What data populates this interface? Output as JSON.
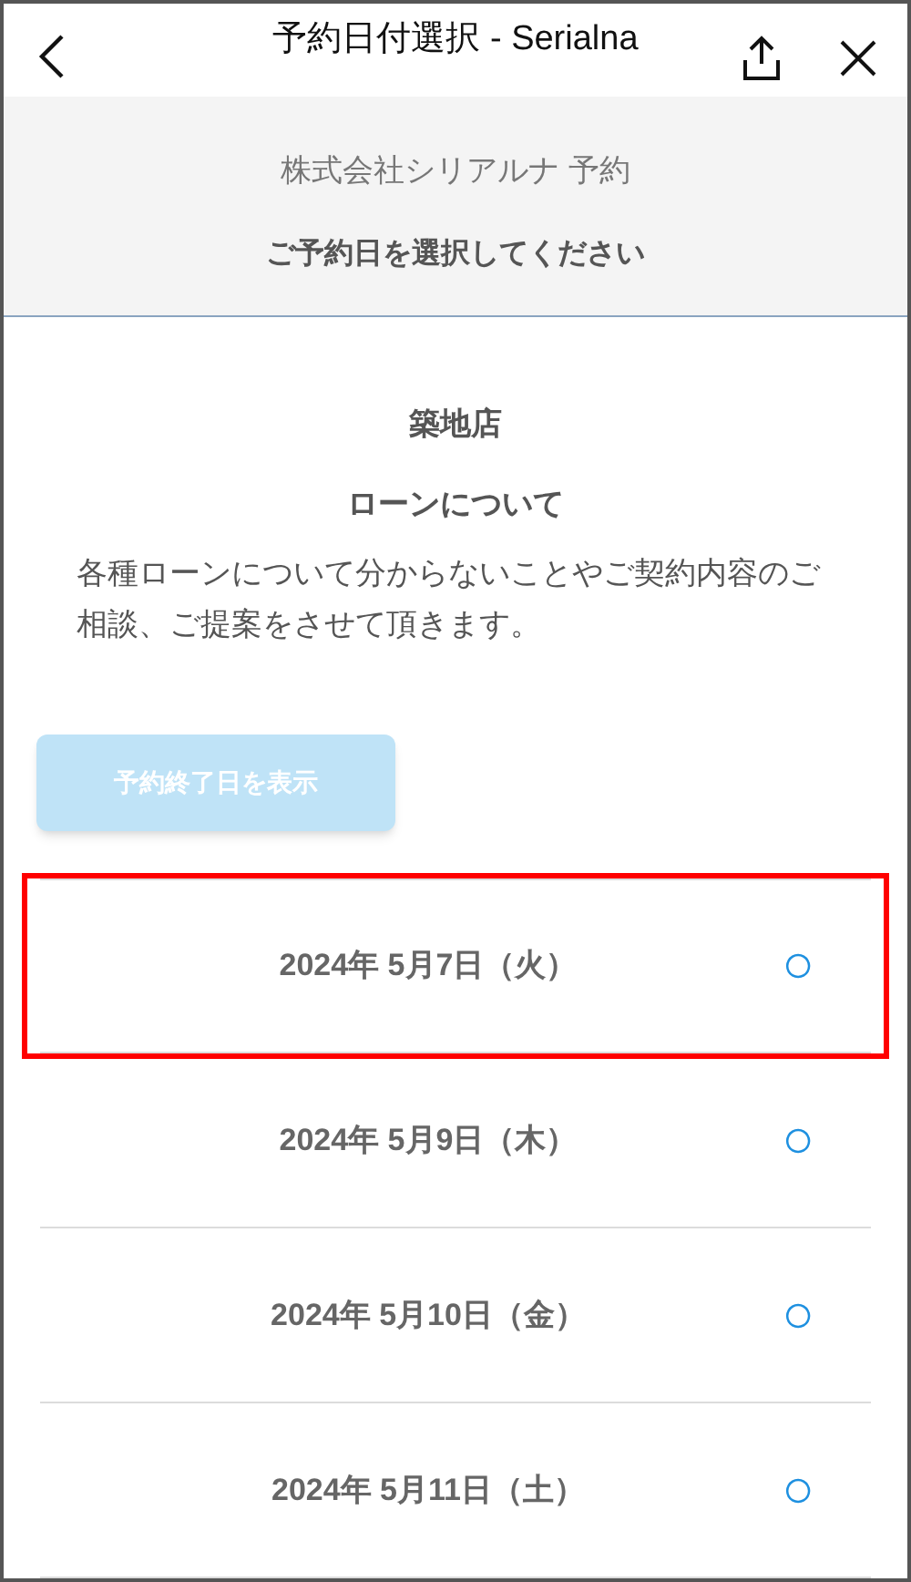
{
  "header": {
    "title": "予約日付選択 - Serialna"
  },
  "banner": {
    "company": "株式会社シリアルナ 予約",
    "instruction": "ご予約日を選択してください"
  },
  "store": {
    "name": "築地店",
    "topic": "ローンについて",
    "description": "各種ローンについて分からないことやご契約内容のご相談、ご提案をさせて頂きます。"
  },
  "end_date_button": {
    "label": "予約終了日を表示",
    "disabled": true
  },
  "dates": [
    {
      "label": "2024年 5月7日（火）",
      "mark": "○",
      "highlighted": true
    },
    {
      "label": "2024年 5月9日（木）",
      "mark": "○",
      "highlighted": false
    },
    {
      "label": "2024年 5月10日（金）",
      "mark": "○",
      "highlighted": false
    },
    {
      "label": "2024年 5月11日（土）",
      "mark": "○",
      "highlighted": false
    }
  ]
}
